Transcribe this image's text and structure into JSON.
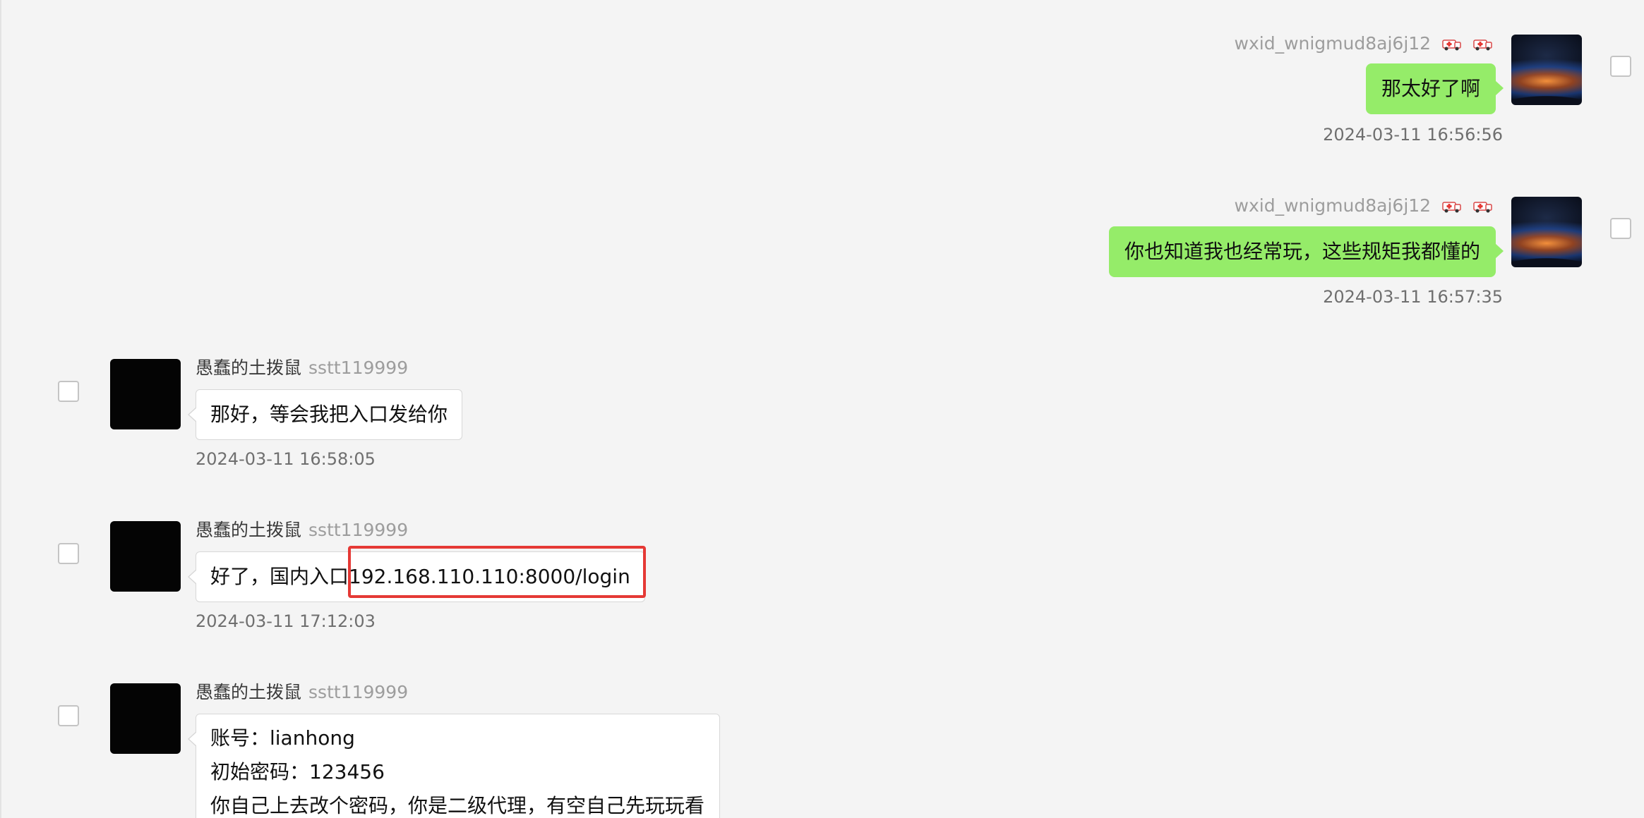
{
  "messages": [
    {
      "side": "right",
      "sender_id": "wxid_wnigmud8aj6j12",
      "text": "那太好了啊",
      "time": "2024-03-11 16:56:56"
    },
    {
      "side": "right",
      "sender_id": "wxid_wnigmud8aj6j12",
      "text": "你也知道我也经常玩，这些规矩我都懂的",
      "time": "2024-03-11 16:57:35"
    },
    {
      "side": "left",
      "sender_name": "愚蠢的土拨鼠",
      "sender_id": "sstt119999",
      "text": "那好，等会我把入口发给你",
      "time": "2024-03-11 16:58:05"
    },
    {
      "side": "left",
      "sender_name": "愚蠢的土拨鼠",
      "sender_id": "sstt119999",
      "text": "好了，国内入口192.168.110.110:8000/login",
      "time": "2024-03-11 17:12:03"
    },
    {
      "side": "left",
      "sender_name": "愚蠢的土拨鼠",
      "sender_id": "sstt119999",
      "lines": [
        "账号：lianhong",
        "初始密码：123456",
        "你自己上去改个密码，你是二级代理，有空自己先玩玩看"
      ]
    }
  ],
  "icons": {
    "sender_badge": "ambulance-sticker-icon",
    "checkbox": "checkbox-icon",
    "avatar_right": "earth-horizon-avatar",
    "avatar_left": "black-avatar"
  },
  "colors": {
    "background": "#f4f4f4",
    "bubble_self": "#95ec69",
    "bubble_other": "#ffffff",
    "highlight": "#e53935"
  }
}
